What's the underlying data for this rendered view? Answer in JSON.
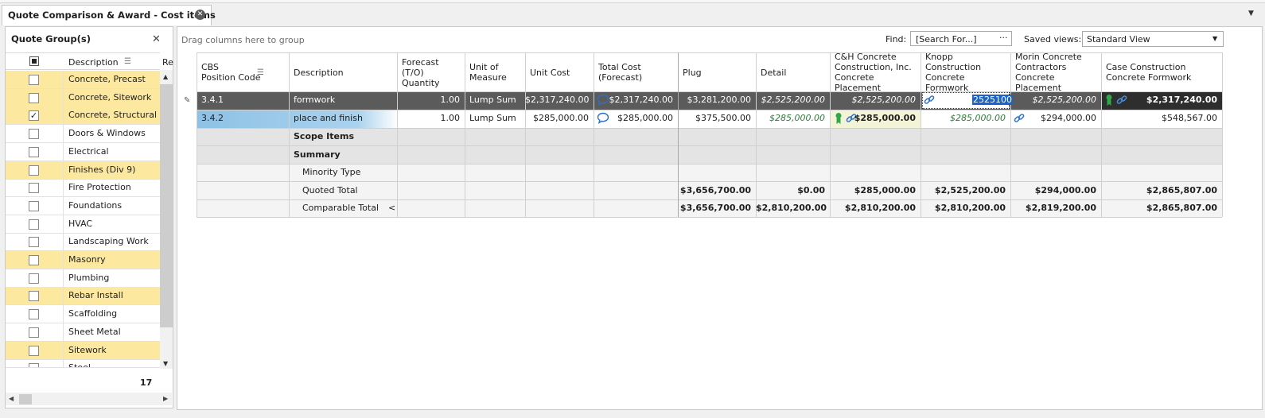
{
  "tab": {
    "title": "Quote Comparison & Award - Cost items"
  },
  "quote_groups": {
    "title": "Quote Group(s)",
    "header_description": "Description",
    "header_re": "Re",
    "items": [
      {
        "label": "Concrete, Precast",
        "checked": false,
        "highlight": true
      },
      {
        "label": "Concrete, Sitework",
        "checked": false,
        "highlight": true
      },
      {
        "label": "Concrete, Structural",
        "checked": true,
        "highlight": true
      },
      {
        "label": "Doors & Windows",
        "checked": false,
        "highlight": false
      },
      {
        "label": "Electrical",
        "checked": false,
        "highlight": false
      },
      {
        "label": "Finishes (Div 9)",
        "checked": false,
        "highlight": true
      },
      {
        "label": "Fire Protection",
        "checked": false,
        "highlight": false
      },
      {
        "label": "Foundations",
        "checked": false,
        "highlight": false
      },
      {
        "label": "HVAC",
        "checked": false,
        "highlight": false
      },
      {
        "label": "Landscaping Work",
        "checked": false,
        "highlight": false
      },
      {
        "label": "Masonry",
        "checked": false,
        "highlight": true
      },
      {
        "label": "Plumbing",
        "checked": false,
        "highlight": false
      },
      {
        "label": "Rebar Install",
        "checked": false,
        "highlight": true
      },
      {
        "label": "Scaffolding",
        "checked": false,
        "highlight": false
      },
      {
        "label": "Sheet Metal",
        "checked": false,
        "highlight": false
      },
      {
        "label": "Sitework",
        "checked": false,
        "highlight": true
      },
      {
        "label": "Steel",
        "checked": false,
        "highlight": false
      }
    ],
    "count": "17"
  },
  "toolbar": {
    "drag_hint": "Drag columns here to group",
    "find_label": "Find:",
    "find_placeholder": "[Search For...]",
    "find_button": "···",
    "saved_views_label": "Saved views:",
    "saved_view": "Standard View"
  },
  "columns": {
    "cbs": "CBS\nPosition Code",
    "description": "Description",
    "forecast_qty": "Forecast\n(T/O)\nQuantity",
    "uom": "Unit of\nMeasure",
    "unit_cost": "Unit Cost",
    "total_cost": "Total Cost\n(Forecast)",
    "plug": "Plug",
    "detail": "Detail",
    "ch": "C&H Concrete\nConstruction, Inc.\nConcrete Placement",
    "knopp": "Knopp Construction\nConcrete Formwork",
    "morin": "Morin Concrete\nContractors\nConcrete Placement",
    "case": "Case Construction\nConcrete Formwork"
  },
  "rows": {
    "r1": {
      "cbs": "3.4.1",
      "description": "formwork",
      "qty": "1.00",
      "uom": "Lump Sum",
      "unit_cost": "$2,317,240.00",
      "total_cost": "$2,317,240.00",
      "plug": "$3,281,200.00",
      "detail": "$2,525,200.00",
      "ch": "$2,525,200.00",
      "knopp_edit": "2525100",
      "morin": "$2,525,200.00",
      "case": "$2,317,240.00"
    },
    "r2": {
      "cbs": "3.4.2",
      "description": "place and finish",
      "qty": "1.00",
      "uom": "Lump Sum",
      "unit_cost": "$285,000.00",
      "total_cost": "$285,000.00",
      "plug": "$375,500.00",
      "detail": "$285,000.00",
      "ch": "$285,000.00",
      "knopp": "$285,000.00",
      "morin": "$294,000.00",
      "case": "$548,567.00"
    },
    "scope_items": "Scope Items",
    "summary": "Summary",
    "minority_type": "Minority Type",
    "quoted_total": {
      "label": "Quoted Total",
      "plug": "$3,656,700.00",
      "detail": "$0.00",
      "ch": "$285,000.00",
      "knopp": "$2,525,200.00",
      "morin": "$294,000.00",
      "case": "$2,865,807.00"
    },
    "comparable_total": {
      "label": "Comparable Total",
      "arrow": "<",
      "plug": "$3,656,700.00",
      "detail": "$2,810,200.00",
      "ch": "$2,810,200.00",
      "knopp": "$2,810,200.00",
      "morin": "$2,819,200.00",
      "case": "$2,865,807.00"
    }
  }
}
